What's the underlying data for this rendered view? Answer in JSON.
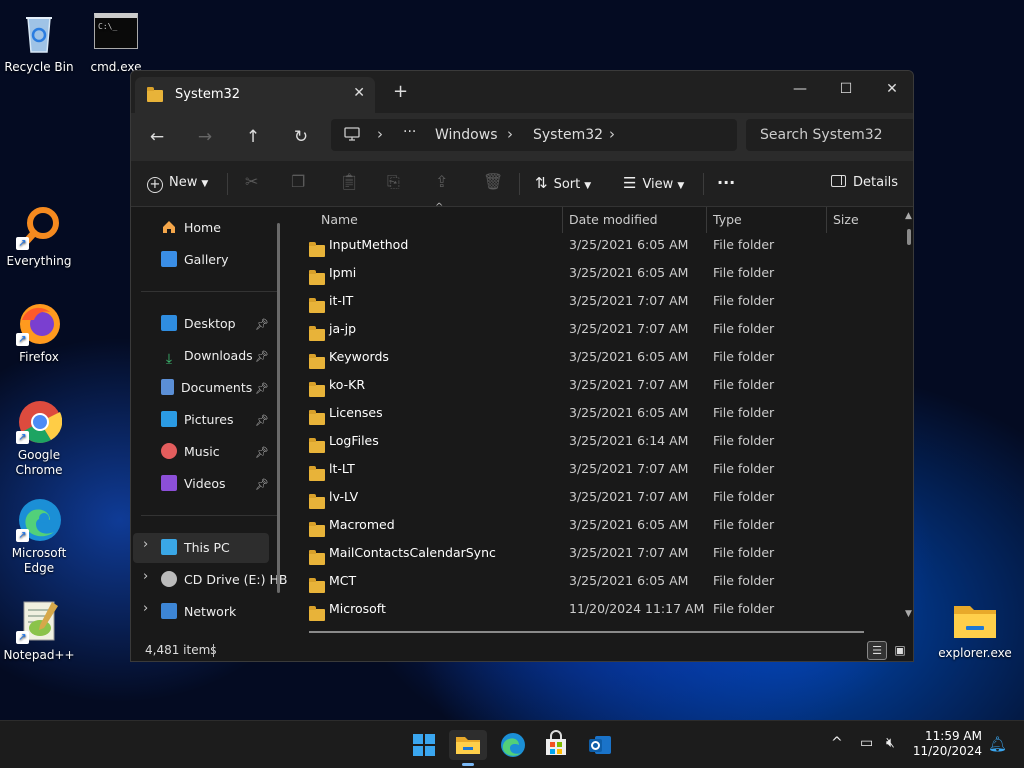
{
  "desktop": {
    "icons": [
      {
        "label": "Recycle Bin"
      },
      {
        "label": "cmd.exe"
      },
      {
        "label": "Everything"
      },
      {
        "label": "Firefox"
      },
      {
        "label": "Google Chrome"
      },
      {
        "label": "Microsoft Edge"
      },
      {
        "label": "Notepad++"
      },
      {
        "label": "explorer.exe"
      }
    ]
  },
  "window": {
    "tab_title": "System32",
    "new_tab": "+",
    "controls": {
      "minimize": "—",
      "maximize": "☐",
      "close": "✕"
    },
    "address": {
      "more": "···",
      "crumbs": [
        "Windows",
        "System32"
      ]
    },
    "search_placeholder": "Search System32",
    "toolbar": {
      "new": "New",
      "sort": "Sort",
      "view": "View",
      "more": "···",
      "details": "Details"
    },
    "nav": {
      "home": "Home",
      "gallery": "Gallery",
      "quick": [
        "Desktop",
        "Downloads",
        "Documents",
        "Pictures",
        "Music",
        "Videos"
      ],
      "this_pc": "This PC",
      "cd_drive": "CD Drive (E:) HB",
      "network": "Network"
    },
    "columns": {
      "name": "Name",
      "date": "Date modified",
      "type": "Type",
      "size": "Size"
    },
    "files": [
      {
        "name": "InputMethod",
        "date": "3/25/2021 6:05 AM",
        "type": "File folder"
      },
      {
        "name": "Ipmi",
        "date": "3/25/2021 6:05 AM",
        "type": "File folder"
      },
      {
        "name": "it-IT",
        "date": "3/25/2021 7:07 AM",
        "type": "File folder"
      },
      {
        "name": "ja-jp",
        "date": "3/25/2021 7:07 AM",
        "type": "File folder"
      },
      {
        "name": "Keywords",
        "date": "3/25/2021 6:05 AM",
        "type": "File folder"
      },
      {
        "name": "ko-KR",
        "date": "3/25/2021 7:07 AM",
        "type": "File folder"
      },
      {
        "name": "Licenses",
        "date": "3/25/2021 6:05 AM",
        "type": "File folder"
      },
      {
        "name": "LogFiles",
        "date": "3/25/2021 6:14 AM",
        "type": "File folder"
      },
      {
        "name": "lt-LT",
        "date": "3/25/2021 7:07 AM",
        "type": "File folder"
      },
      {
        "name": "lv-LV",
        "date": "3/25/2021 7:07 AM",
        "type": "File folder"
      },
      {
        "name": "Macromed",
        "date": "3/25/2021 6:05 AM",
        "type": "File folder"
      },
      {
        "name": "MailContactsCalendarSync",
        "date": "3/25/2021 7:07 AM",
        "type": "File folder"
      },
      {
        "name": "MCT",
        "date": "3/25/2021 6:05 AM",
        "type": "File folder"
      },
      {
        "name": "Microsoft",
        "date": "11/20/2024 11:17 AM",
        "type": "File folder"
      }
    ],
    "status": {
      "items": "4,481 items"
    }
  },
  "taskbar": {
    "time": "11:59 AM",
    "date": "11/20/2024"
  },
  "colors": {
    "accent": "#0078d4",
    "folder": "#e8b339"
  }
}
